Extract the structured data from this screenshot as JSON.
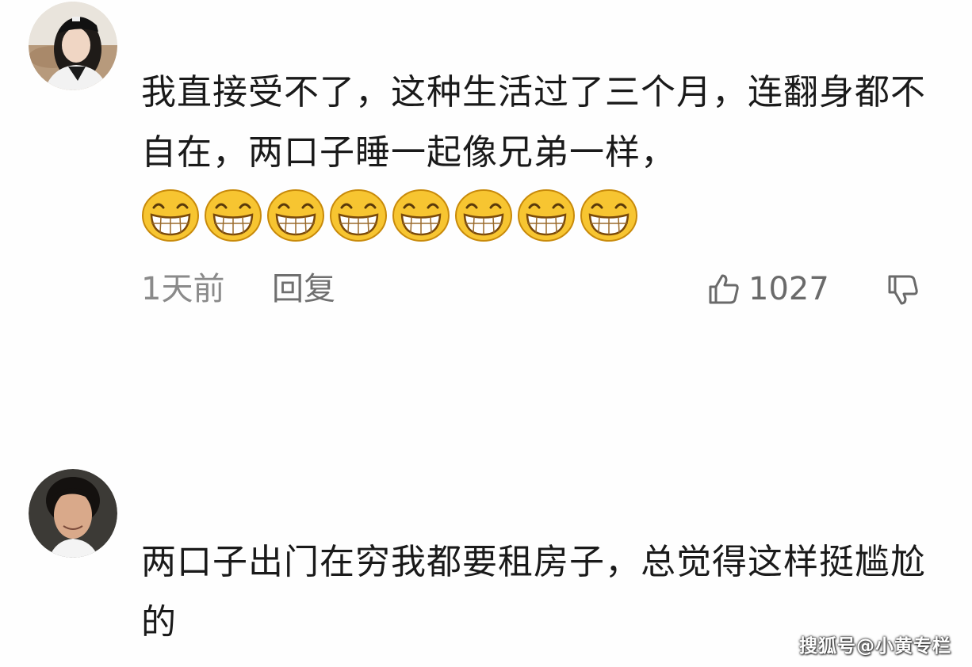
{
  "comments": [
    {
      "text": "我直接受不了，这种生活过了三个月，连翻身都不自在，两口子睡一起像兄弟一样，",
      "emoji_count": 8,
      "emoji_icon": "grinning-face-icon",
      "time": "1天前",
      "reply_label": "回复",
      "likes": "1027",
      "like_icon": "thumbs-up-icon",
      "dislike_icon": "thumbs-down-icon"
    },
    {
      "text": "两口子出门在穷我都要租房子，总觉得这样挺尴尬的"
    }
  ],
  "watermark": "搜狐号@小黄专栏",
  "colors": {
    "text": "#1a1a1a",
    "meta": "#8a8a8a",
    "emoji_face": "#f7c531",
    "emoji_outline": "#c88a0a"
  }
}
